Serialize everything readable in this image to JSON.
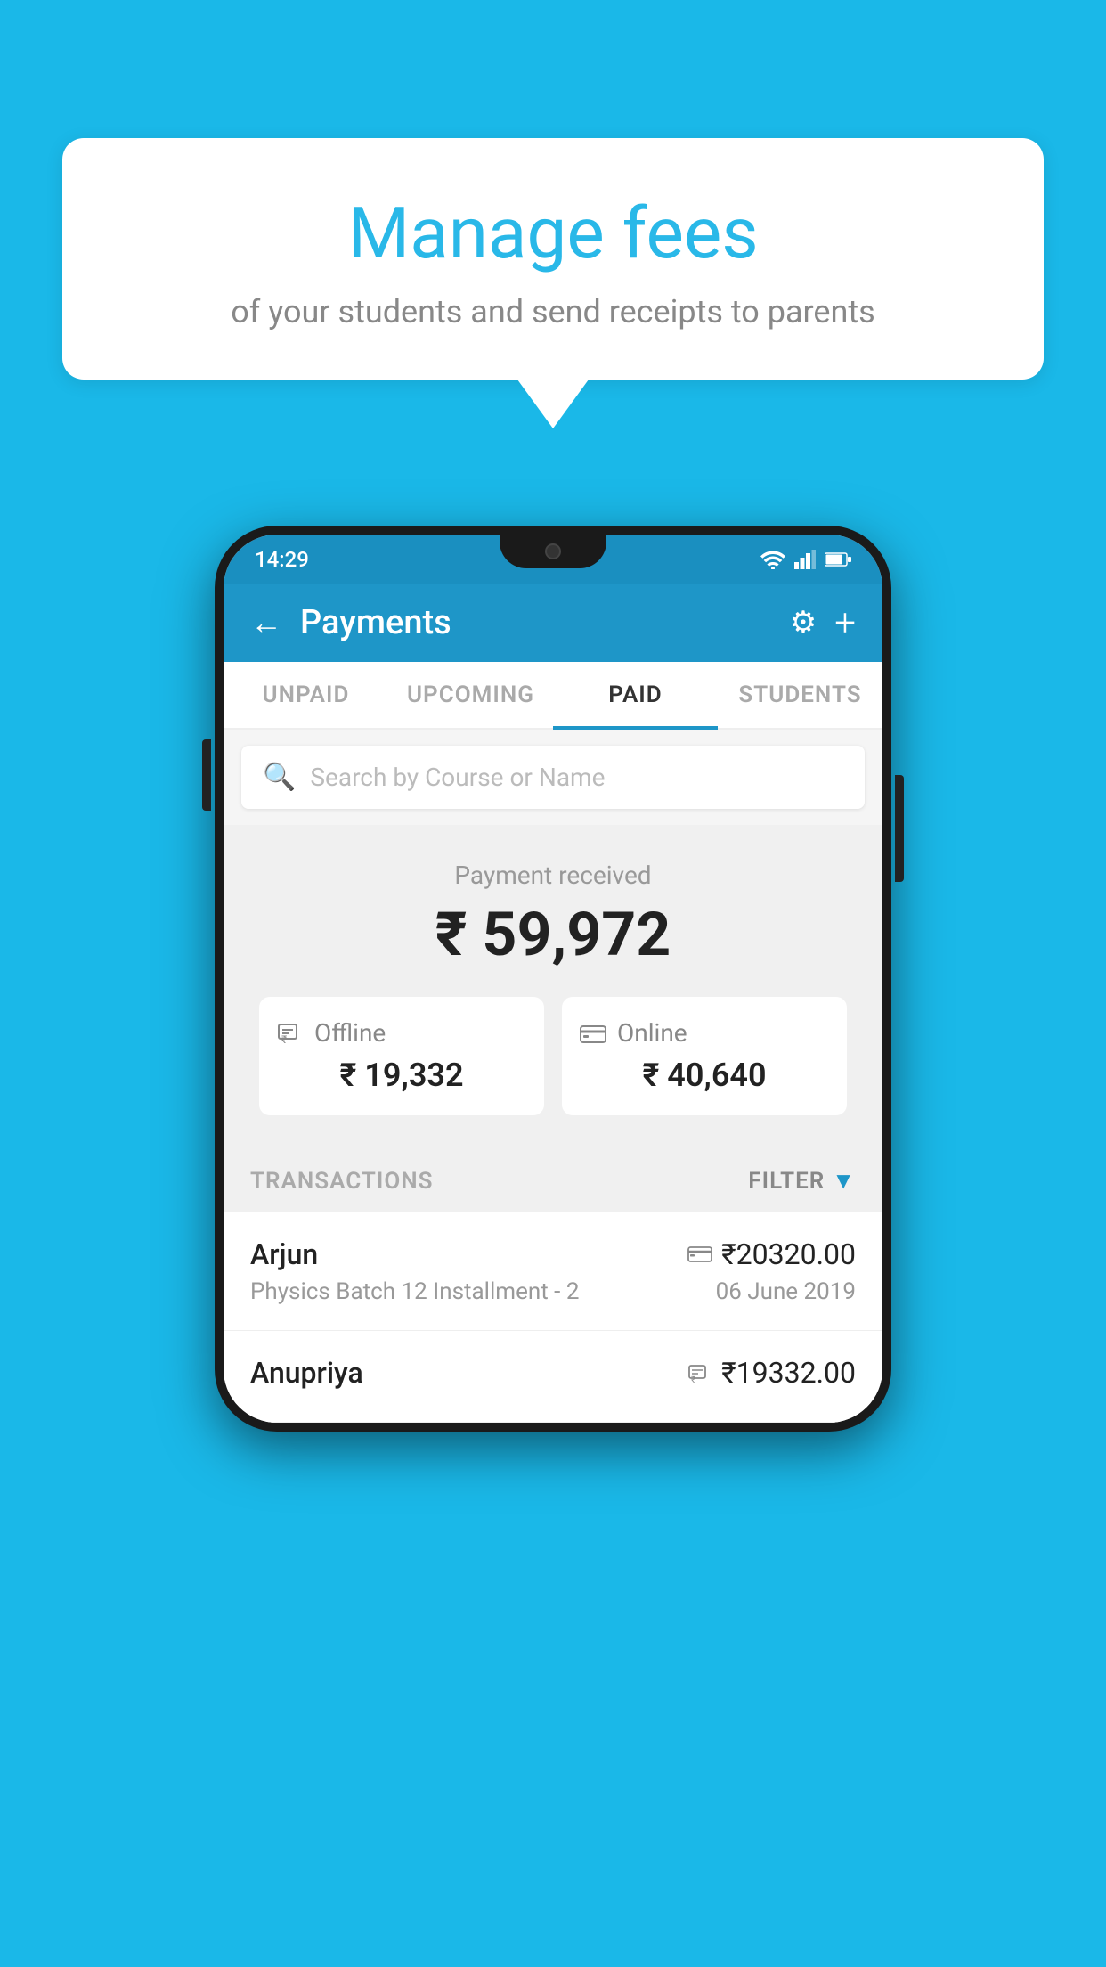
{
  "background_color": "#1ab8e8",
  "speech_bubble": {
    "title": "Manage fees",
    "subtitle": "of your students and send receipts to parents"
  },
  "status_bar": {
    "time": "14:29",
    "icons": [
      "wifi",
      "signal",
      "battery"
    ]
  },
  "header": {
    "title": "Payments",
    "back_icon": "←",
    "settings_icon": "⚙",
    "add_icon": "+"
  },
  "tabs": [
    {
      "label": "UNPAID",
      "active": false
    },
    {
      "label": "UPCOMING",
      "active": false
    },
    {
      "label": "PAID",
      "active": true
    },
    {
      "label": "STUDENTS",
      "active": false
    }
  ],
  "search": {
    "placeholder": "Search by Course or Name"
  },
  "payment_summary": {
    "label": "Payment received",
    "amount": "₹ 59,972",
    "offline": {
      "icon": "💳",
      "label": "Offline",
      "amount": "₹ 19,332"
    },
    "online": {
      "icon": "💳",
      "label": "Online",
      "amount": "₹ 40,640"
    }
  },
  "transactions": {
    "header_label": "TRANSACTIONS",
    "filter_label": "FILTER",
    "rows": [
      {
        "name": "Arjun",
        "course": "Physics Batch 12 Installment - 2",
        "amount": "₹20320.00",
        "date": "06 June 2019",
        "mode": "online"
      },
      {
        "name": "Anupriya",
        "course": "",
        "amount": "₹19332.00",
        "date": "",
        "mode": "offline"
      }
    ]
  }
}
